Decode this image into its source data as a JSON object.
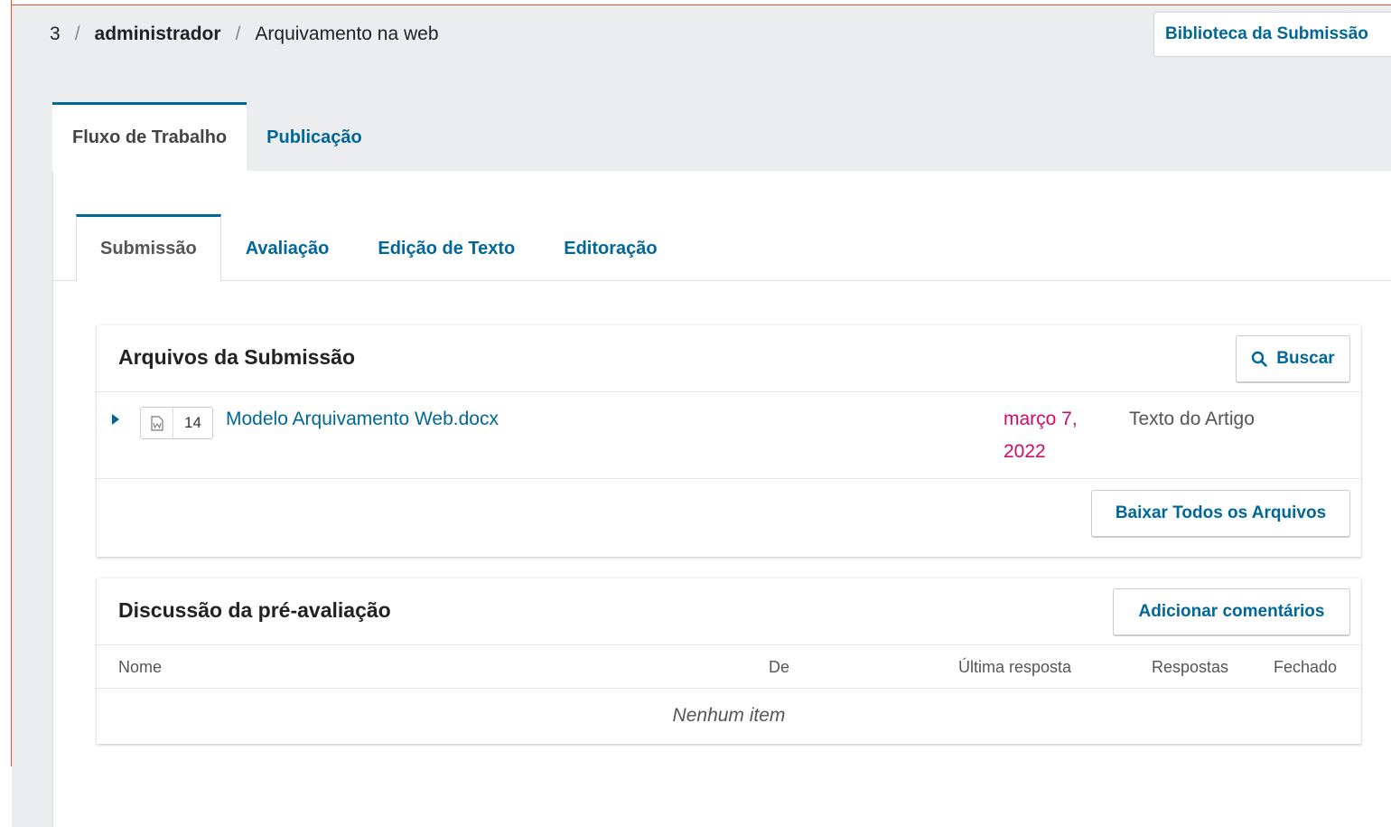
{
  "breadcrumb": {
    "items": [
      "3",
      "administrador",
      "Arquivamento na web"
    ],
    "separator": "/"
  },
  "header": {
    "library_button": "Biblioteca da Submissão"
  },
  "top_tabs": [
    {
      "label": "Fluxo de Trabalho",
      "active": true
    },
    {
      "label": "Publicação",
      "active": false
    }
  ],
  "stage_tabs": [
    {
      "label": "Submissão",
      "active": true
    },
    {
      "label": "Avaliação",
      "active": false
    },
    {
      "label": "Edição de Texto",
      "active": false
    },
    {
      "label": "Editoração",
      "active": false
    }
  ],
  "files_panel": {
    "title": "Arquivos da Submissão",
    "search_label": "Buscar",
    "download_all_label": "Baixar Todos os Arquivos",
    "files": [
      {
        "id": "14",
        "name": "Modelo Arquivamento Web.docx",
        "date": "março 7, 2022",
        "type": "Texto do Artigo",
        "icon": "word-document-icon"
      }
    ]
  },
  "discussion_panel": {
    "title": "Discussão da pré-avaliação",
    "add_label": "Adicionar comentários",
    "columns": [
      "Nome",
      "De",
      "Última resposta",
      "Respostas",
      "Fechado"
    ],
    "empty_text": "Nenhum item"
  },
  "colors": {
    "link": "#006798",
    "date": "#d00a6c",
    "background": "#ebedee",
    "frame": "#e8503a"
  }
}
